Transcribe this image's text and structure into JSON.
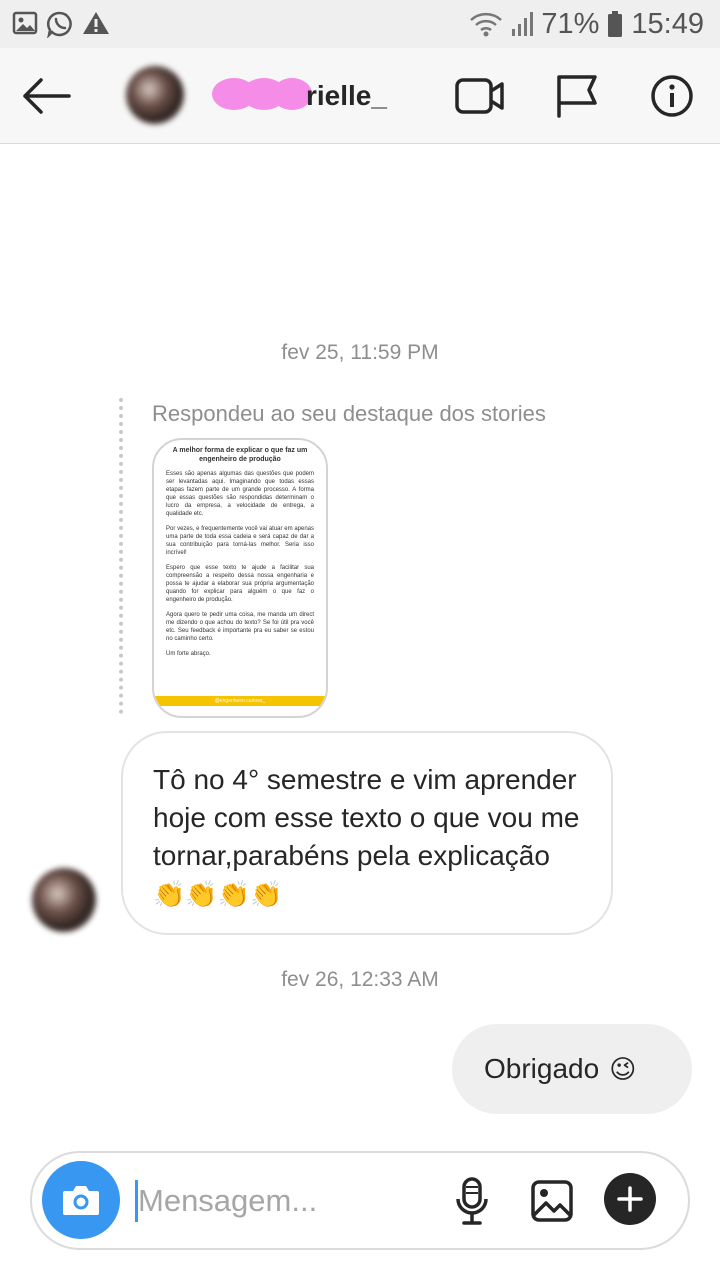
{
  "status_bar": {
    "battery": "71%",
    "time": "15:49",
    "icons": [
      "image-icon",
      "whatsapp-icon",
      "warning-icon",
      "wifi-icon",
      "signal-icon",
      "battery-icon"
    ]
  },
  "header": {
    "username": "rielle_",
    "icons": [
      "back-arrow-icon",
      "video-call-icon",
      "flag-icon",
      "info-icon"
    ]
  },
  "chat": {
    "timestamp_1": "fev 25, 11:59 PM",
    "reply_caption": "Respondeu ao seu destaque dos stories",
    "story": {
      "title": "A melhor forma de explicar o que faz um engenheiro de produção",
      "paragraphs": [
        "Esses são apenas algumas das questões que podem ser levantadas aqui. Imaginando que todas essas etapas fazem parte de um grande processo. A forma que essas questões são respondidas determinam o lucro da empresa, a velocidade de entrega, a qualidade etc.",
        "Por vezes, e frequentemente você vai atuar em apenas uma parte de toda essa cadeia e será capaz de dar a sua contribuição para torná-las melhor. Seria isso incrível!",
        "Espero que esse texto te ajude a facilitar sua compreensão a respeito dessa nossa engenharia e possa te ajudar a elaborar sua própria argumentação quando for explicar para alguém o que faz o engenheiro de produção.",
        "Agora quero te pedir uma coisa, me manda um direct me dizendo o que achou do texto? Se foi útil pra você etc. Seu feedback é importante pra eu saber se estou no caminho certo.",
        "Um forte abraço."
      ],
      "footer": "@engenheiro.curioso_"
    },
    "incoming_message": "Tô no 4° semestre e vim aprender hoje com esse texto o que vou me tornar,parabéns pela explicação",
    "incoming_emoji": "👏👏👏👏",
    "timestamp_2": "fev 26, 12:33 AM",
    "outgoing_message": "Obrigado",
    "outgoing_emoji": "😉"
  },
  "composer": {
    "placeholder": "Mensagem...",
    "icons": [
      "camera-icon",
      "microphone-icon",
      "gallery-icon",
      "plus-icon"
    ],
    "accent": "#3897f0"
  }
}
